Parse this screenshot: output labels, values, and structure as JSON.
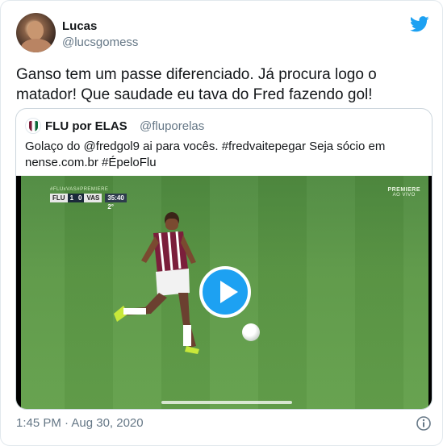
{
  "author": {
    "display_name": "Lucas",
    "handle": "@lucsgomess"
  },
  "tweet": {
    "text": "Ganso tem um passe diferenciado. Já procura logo o matador! Que saudade eu tava do Fred fazendo gol!",
    "timestamp": "1:45 PM · Aug 30, 2020"
  },
  "quoted": {
    "display_name": "FLU por ELAS",
    "handle": "@fluporelas",
    "text": "Golaço do @fredgol9 ai para vocês. #fredvaitepegar Seja sócio em nense.com.br #ÉpeloFlu",
    "video": {
      "scorebug": {
        "tag": "#FLUxVAS#PREMIERE",
        "home": "FLU",
        "home_score": "1",
        "away_score": "0",
        "away": "VAS",
        "clock": "35:40 2°"
      },
      "broadcaster": "PREMIERE",
      "broadcast_status": "AO VIVO",
      "progress": 0.0
    }
  },
  "icons": {
    "brand": "twitter-bird-icon",
    "play": "play-icon",
    "info": "info-icon"
  },
  "colors": {
    "accent": "#1da1f2",
    "secondary_text": "#657786",
    "border": "#e1e8ed"
  }
}
